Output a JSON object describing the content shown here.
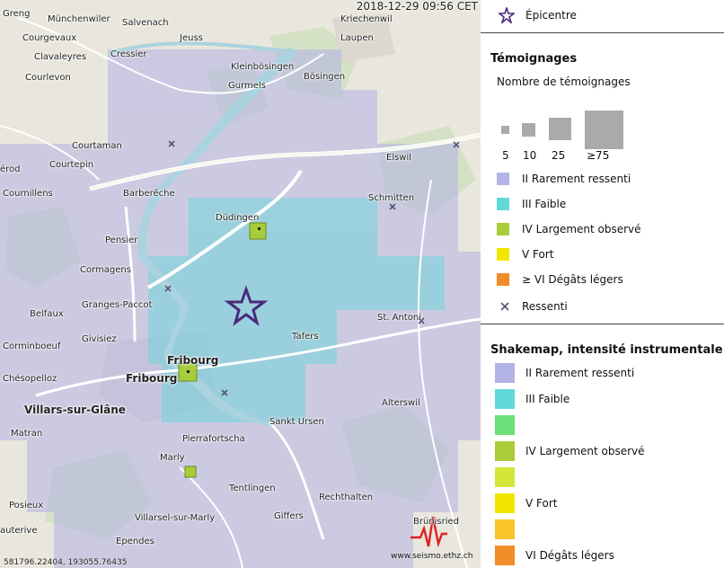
{
  "map": {
    "timestamp": "2018-12-29 09:56 CET",
    "coordinates": "581796.22404, 193055.76435",
    "logo_url": "www.seismo.ethz.ch",
    "places": [
      {
        "name": "Greng",
        "style": "normal"
      },
      {
        "name": "Münchenwiler",
        "style": "normal"
      },
      {
        "name": "Salvenach",
        "style": "normal"
      },
      {
        "name": "Kriechenwil",
        "style": "normal"
      },
      {
        "name": "Courgevaux",
        "style": "normal"
      },
      {
        "name": "Jeuss",
        "style": "normal"
      },
      {
        "name": "Laupen",
        "style": "normal"
      },
      {
        "name": "Clavaleyres",
        "style": "normal"
      },
      {
        "name": "Cressier",
        "style": "normal"
      },
      {
        "name": "Kleinbösingen",
        "style": "normal"
      },
      {
        "name": "Courlevon",
        "style": "normal"
      },
      {
        "name": "Bösingen",
        "style": "normal"
      },
      {
        "name": "Gurmels",
        "style": "normal"
      },
      {
        "name": "Courtaman",
        "style": "normal"
      },
      {
        "name": "Courtepin",
        "style": "normal"
      },
      {
        "name": "Elswil",
        "style": "normal"
      },
      {
        "name": "érod",
        "style": "normal"
      },
      {
        "name": "Barberêche",
        "style": "normal"
      },
      {
        "name": "Cournillens",
        "style": "normal"
      },
      {
        "name": "Schmitten",
        "style": "normal"
      },
      {
        "name": "Düdingen",
        "style": "normal"
      },
      {
        "name": "Pensier",
        "style": "normal"
      },
      {
        "name": "Cormagens",
        "style": "normal"
      },
      {
        "name": "Granges-Paccot",
        "style": "normal"
      },
      {
        "name": "Belfaux",
        "style": "normal"
      },
      {
        "name": "St. Antoni",
        "style": "normal"
      },
      {
        "name": "Givisiez",
        "style": "normal"
      },
      {
        "name": "Tafers",
        "style": "normal"
      },
      {
        "name": "Corminboeuf",
        "style": "normal"
      },
      {
        "name": "Fribourg",
        "style": "big"
      },
      {
        "name": "Fribourg",
        "style": "big"
      },
      {
        "name": "Chésopelloz",
        "style": "normal"
      },
      {
        "name": "Alterswil",
        "style": "normal"
      },
      {
        "name": "Villars-sur-Glâne",
        "style": "big"
      },
      {
        "name": "Sankt Ursen",
        "style": "normal"
      },
      {
        "name": "Matran",
        "style": "normal"
      },
      {
        "name": "Pierrafortscha",
        "style": "normal"
      },
      {
        "name": "Marly",
        "style": "normal"
      },
      {
        "name": "Tentlingen",
        "style": "normal"
      },
      {
        "name": "Rechthalten",
        "style": "normal"
      },
      {
        "name": "Posieux",
        "style": "normal"
      },
      {
        "name": "Giffers",
        "style": "normal"
      },
      {
        "name": "Brünisried",
        "style": "normal"
      },
      {
        "name": "Villarsel-sur-Marly",
        "style": "normal"
      },
      {
        "name": "auterive",
        "style": "normal"
      },
      {
        "name": "Ependes",
        "style": "normal"
      }
    ]
  },
  "legend": {
    "epicentre": "Épicentre",
    "testimonies": {
      "title": "Témoignages",
      "subtitle": "Nombre de témoignages",
      "sizes": [
        "5",
        "10",
        "25",
        "≥75"
      ],
      "items": [
        {
          "label": "II Rarement ressenti",
          "color": "#b3b3e6"
        },
        {
          "label": "III Faible",
          "color": "#5fd9d9"
        },
        {
          "label": "IV Largement observé",
          "color": "#a8cc3a"
        },
        {
          "label": "V Fort",
          "color": "#f2e600"
        },
        {
          "label": "≥ VI Dégâts légers",
          "color": "#f28c28"
        },
        {
          "label": "Ressenti",
          "color": "#555577"
        }
      ]
    },
    "shakemap": {
      "title": "Shakemap, intensité instrumentale",
      "items": [
        {
          "label": "II Rarement ressenti",
          "color": "#b3b3e6"
        },
        {
          "label": "III Faible",
          "color": "#5fd9d9"
        },
        {
          "label": "",
          "color": "#6ee07a"
        },
        {
          "label": "IV Largement observé",
          "color": "#a8cc3a"
        },
        {
          "label": "",
          "color": "#d4e63a"
        },
        {
          "label": "V Fort",
          "color": "#f2e600"
        },
        {
          "label": "",
          "color": "#f9c32a"
        },
        {
          "label": "VI Dégâts légers",
          "color": "#f28c28"
        }
      ]
    }
  }
}
